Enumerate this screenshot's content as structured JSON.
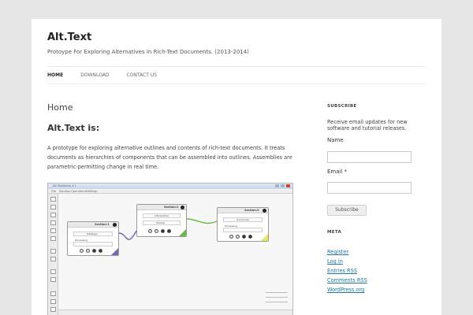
{
  "site": {
    "title": "Alt.Text",
    "description": "Protoype For Exploring Alternatives In Rich-Text Documents. (2013-2014)"
  },
  "nav": {
    "items": [
      {
        "label": "HOME"
      },
      {
        "label": "DOWNLOAD"
      },
      {
        "label": "CONTACT US"
      }
    ]
  },
  "main": {
    "title": "Home",
    "subtitle": "Alt.Text is:",
    "body": "A prototype for exploring alternative outlines and contents of rich-text documents. It treats documents as hierarchies of components that can be assembled into outlines. Assemblies are parametric-permitting change in real time."
  },
  "screenshot": {
    "window_title": "Alt.TextAlpha 4.1",
    "menu": [
      "File",
      "Solution",
      "Operations",
      "Settings"
    ],
    "node1": {
      "title": "Section:1",
      "row1": "Datatype",
      "row2": "Processing"
    },
    "node2": {
      "title": "Section:2",
      "row1": "Introduction",
      "row2": "Tutorial"
    },
    "node3": {
      "title": "Section:3",
      "row1": "Conclusion",
      "row2": "Processing"
    }
  },
  "sidebar": {
    "subscribe": {
      "title": "SUBSCRIBE",
      "text": "Receive email updates for new software and tutorial releases.",
      "name_label": "Name",
      "email_label": "Email *",
      "button": "Subscribe"
    },
    "meta": {
      "title": "META",
      "links": [
        {
          "label": "Register"
        },
        {
          "label": "Log in"
        },
        {
          "label": "Entries RSS"
        },
        {
          "label": "Comments RSS"
        },
        {
          "label": "WordPress.org"
        }
      ]
    }
  },
  "colors": {
    "link": "#21759b",
    "node_accent_purple": "#7a68b5",
    "node_accent_green": "#6fb848",
    "node_accent_yellow": "#e9e36a"
  }
}
